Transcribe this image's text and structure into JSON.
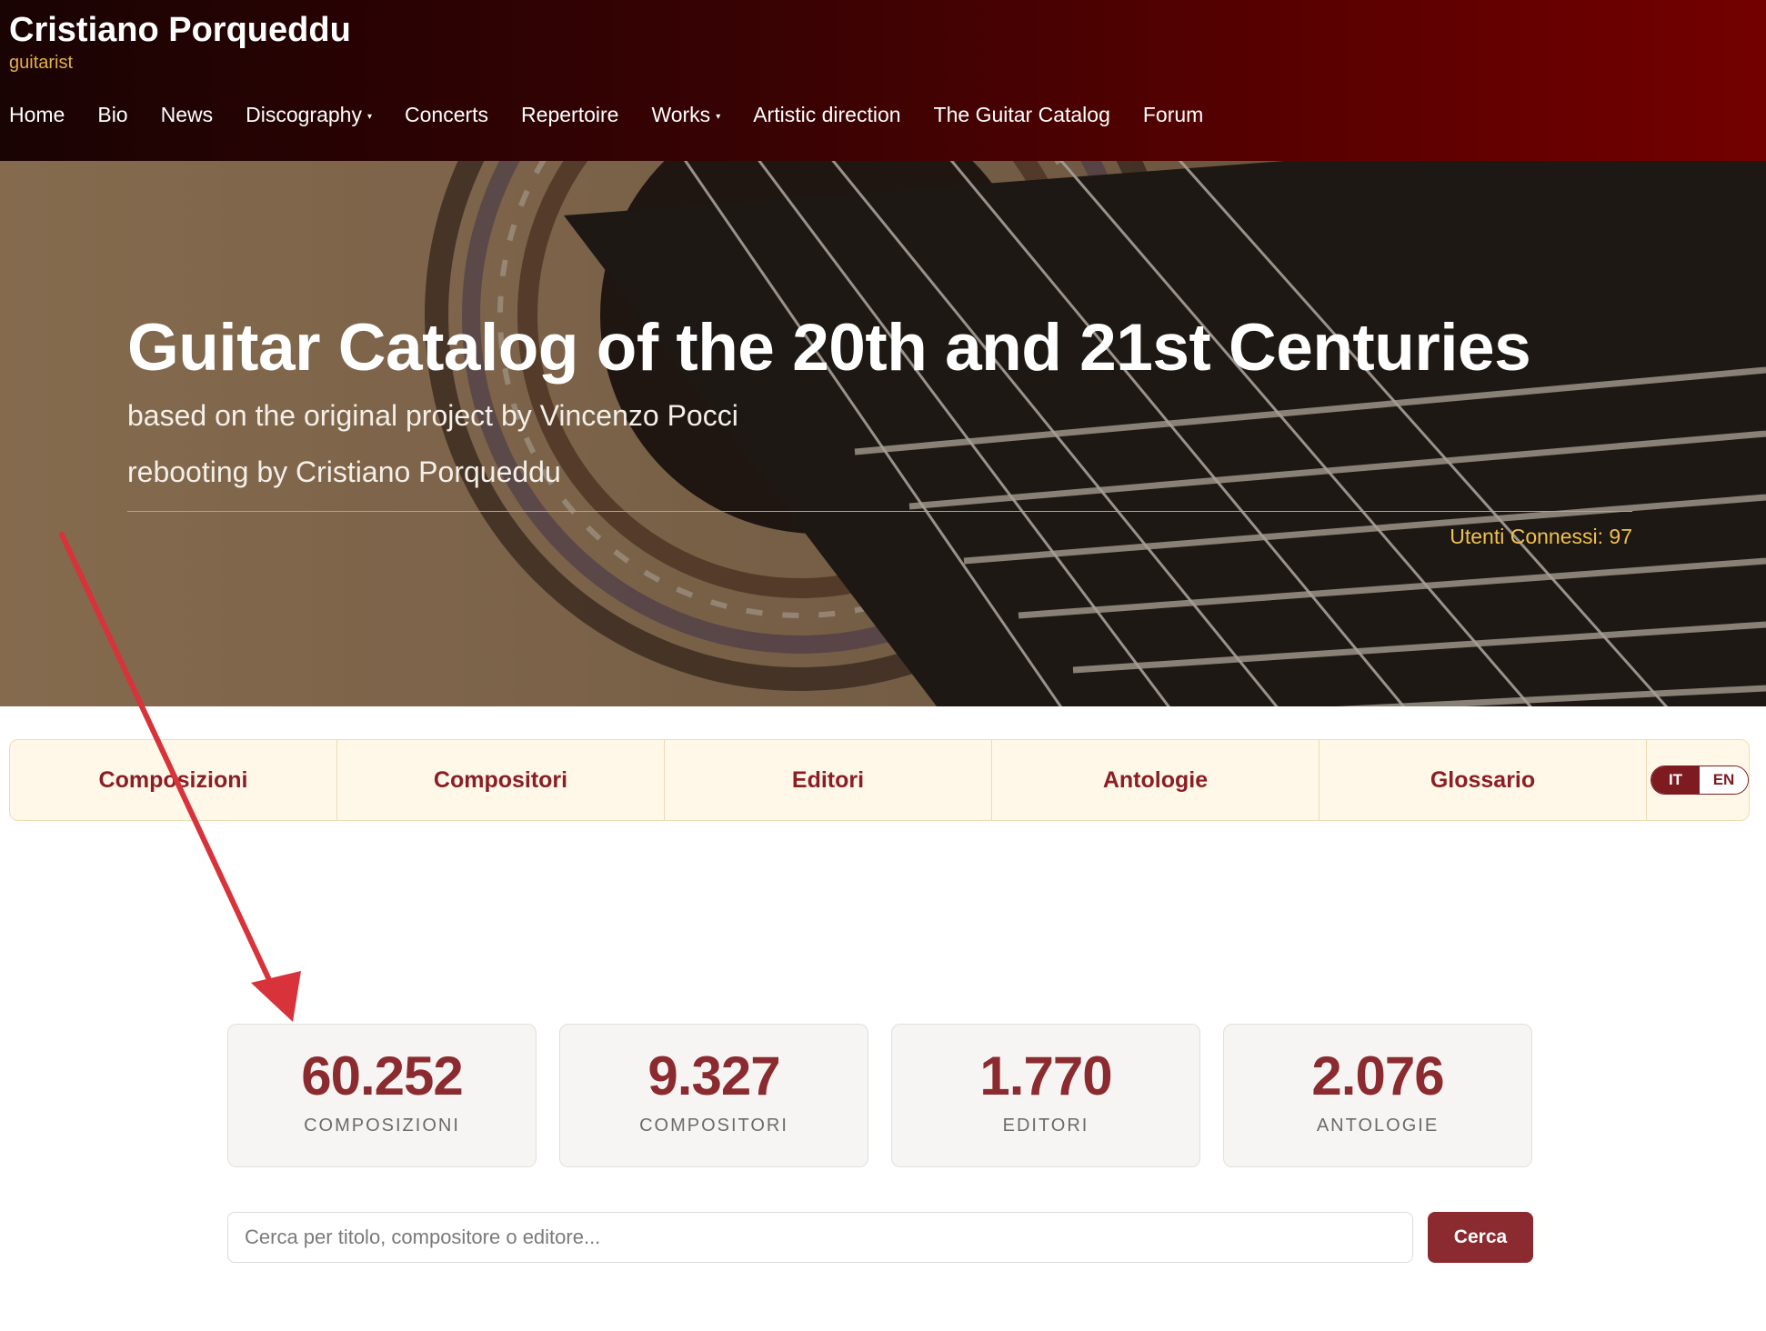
{
  "header": {
    "site_title": "Cristiano Porqueddu",
    "site_subtitle": "guitarist",
    "nav": [
      {
        "label": "Home"
      },
      {
        "label": "Bio"
      },
      {
        "label": "News"
      },
      {
        "label": "Discography",
        "caret": "▾"
      },
      {
        "label": "Concerts"
      },
      {
        "label": "Repertoire"
      },
      {
        "label": "Works",
        "caret": "▾"
      },
      {
        "label": "Artistic direction"
      },
      {
        "label": "The Guitar Catalog"
      },
      {
        "label": "Forum"
      }
    ]
  },
  "hero": {
    "title": "Guitar Catalog of the 20th and 21st Centuries",
    "line1": "based on the original project by Vincenzo Pocci",
    "line2": "rebooting by Cristiano Porqueddu",
    "online_users": "Utenti Connessi: 97"
  },
  "tabs": [
    {
      "label": "Composizioni"
    },
    {
      "label": "Compositori"
    },
    {
      "label": "Editori"
    },
    {
      "label": "Antologie"
    },
    {
      "label": "Glossario"
    }
  ],
  "language": {
    "active": "IT",
    "other": "EN"
  },
  "stats": [
    {
      "value": "60.252",
      "label": "COMPOSIZIONI"
    },
    {
      "value": "9.327",
      "label": "COMPOSITORI"
    },
    {
      "value": "1.770",
      "label": "EDITORI"
    },
    {
      "value": "2.076",
      "label": "ANTOLOGIE"
    }
  ],
  "search": {
    "placeholder": "Cerca per titolo, compositore o editore...",
    "button_label": "Cerca"
  },
  "colors": {
    "brand_dark_red": "#8b2a2f",
    "header_gold": "#e2b04a",
    "annotation_arrow": "#d8323a"
  }
}
